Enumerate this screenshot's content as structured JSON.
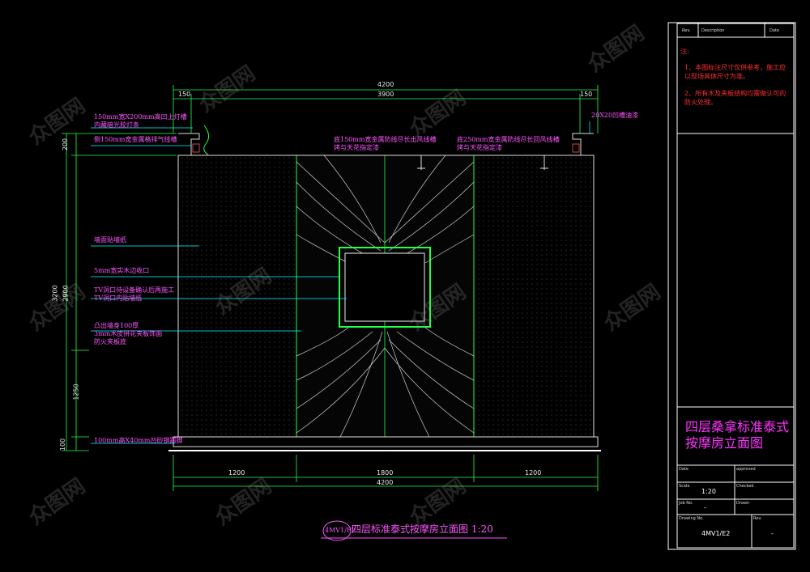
{
  "title_block": {
    "header": {
      "rev": "Rev.",
      "description": "Description",
      "date": "Date"
    },
    "notes_label": "注:",
    "notes": [
      "1、本图标注尺寸仅供参考，施工应以现场具体尺寸为准。",
      "2、所有木及夹板结构均需做认可的防火处理。"
    ],
    "drawing_title": "四层桑拿标准泰式按摩房立面图",
    "fields": {
      "date_label": "Date",
      "approved_label": "approved",
      "scale_label": "Scale",
      "scale_value": "1:20",
      "checked_label": "Checked",
      "job_label": "Job No.",
      "job_value": "-",
      "drawn_label": "Drawn",
      "drawing_no_label": "Drawing No.",
      "drawing_no_value": "4MV1/E2",
      "rev_label": "Rev.",
      "rev_value": "-"
    }
  },
  "elevation": {
    "dims_top": {
      "overall": "4200",
      "inner": "3900",
      "left_end": "150",
      "right_end": "150"
    },
    "dims_bottom": {
      "left": "1200",
      "middle": "1800",
      "right": "1200",
      "overall": "4200"
    },
    "dims_left": {
      "total": "3200",
      "d200": "200",
      "d2900": "2900",
      "d1250": "1250",
      "d100": "100"
    },
    "annotations": {
      "light_trough": "150mm宽X200mm高凹上灯槽",
      "light_strip": "内藏暗光胶灯条",
      "side_exhaust": "侧150mm宽金属格排气线槽",
      "wallpaper": "墙面贴墙纸",
      "wood_frame": "5mm宽实木边收口",
      "tv_1": "TV洞口待设备确认后再施工",
      "tv_2": "TV洞口内贴墙纸",
      "panel_1": "凸出墙身100厚",
      "panel_2": "3mm木皮拼花夹板饰面",
      "panel_3": "防火夹板底",
      "baseboard": "100mm高X40mm凹砂钢踢脚",
      "vent_left_1": "底150mm宽金属防线尽长出风线槽",
      "vent_left_2": "烤与天花指定漆",
      "vent_right_1": "底250mm宽金属防线尽长回风线槽",
      "vent_right_2": "烤与天花指定漆",
      "slot_right": "20X20凹槽油漆"
    },
    "drawing_tag": "4MV1/E2",
    "drawing_caption": "四层标准泰式按摩房立面图 1:20"
  },
  "watermark": "众图网",
  "colors": {
    "wall": "#ffffff",
    "dimension": "#00ff66",
    "leader": "#00ffff",
    "annotation": "#ff55ff",
    "note": "#ff3030",
    "frame": "#ffffff"
  }
}
